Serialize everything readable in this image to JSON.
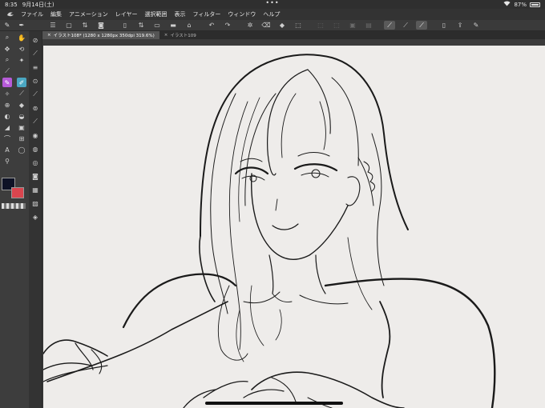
{
  "status": {
    "time": "8:35",
    "date": "9月14日(土)",
    "dots": "•••",
    "battery_text": "87%"
  },
  "menu": {
    "items": [
      "ファイル",
      "編集",
      "アニメーション",
      "レイヤー",
      "選択範囲",
      "表示",
      "フィルター",
      "ウィンドウ",
      "ヘルプ"
    ]
  },
  "tabs": [
    {
      "label": "イラスト108* (1280 x 1280px 350dpi 319.6%)",
      "close": "×"
    },
    {
      "label": "イラスト109",
      "close": "×"
    }
  ],
  "colors": {
    "main_color": "#0e1226",
    "sub_color": "#d9454e",
    "accent_tool": "#b65bd8"
  },
  "icons": {
    "tools_col1": [
      "pen-icon",
      "brush-icon",
      "zoom-icon",
      "hand-icon",
      "move-icon",
      "rotate-icon",
      "lasso-icon",
      "wand-icon",
      "eyedropper-icon",
      "pencil-icon",
      "sparkle-icon",
      "tone-icon",
      "fill-icon",
      "eraser-icon",
      "bucket-icon",
      "blend-icon",
      "shape-icon",
      "figure-icon",
      "curve-icon",
      "ruler-icon",
      "text-icon",
      "balloon-icon",
      "person-icon"
    ],
    "tools_col2": [
      "navigator-icon",
      "brush-size-icon",
      "slider-icon",
      "color-wheel-icon",
      "tool-property-icon",
      "layer-property-icon",
      "brush-size2-icon",
      "fill-icon",
      "subtool-icon",
      "color-circle-icon",
      "camera-icon",
      "material-icon",
      "image-icon",
      "layers-icon"
    ]
  }
}
